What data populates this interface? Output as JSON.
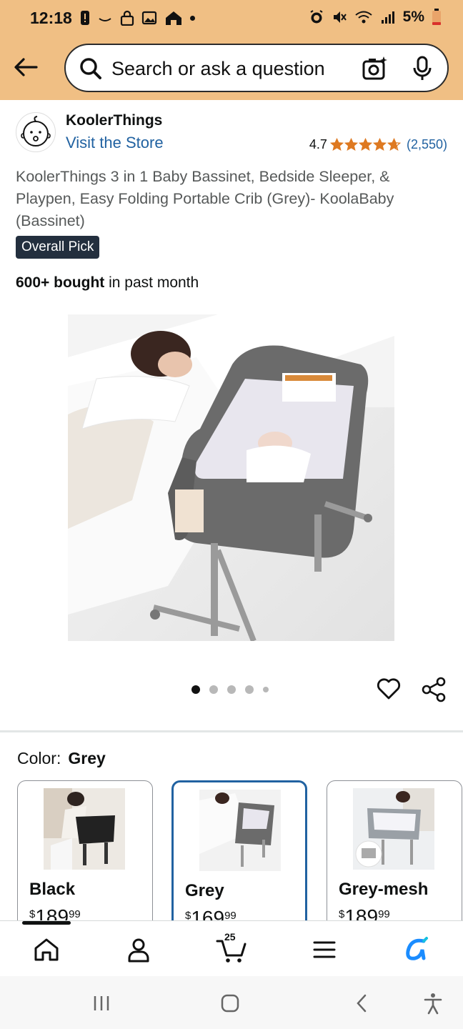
{
  "status_bar": {
    "time": "12:18",
    "battery": "5%"
  },
  "header": {
    "search_placeholder": "Search or ask a question",
    "bg_color": "#f0bf84"
  },
  "store": {
    "name": "KoolerThings",
    "visit_link": "Visit the Store",
    "rating_value": "4.7",
    "rating_count": "(2,550)",
    "stars": 4.7
  },
  "product": {
    "title": "KoolerThings 3 in 1 Baby Bassinet, Bedside Sleeper, & Playpen, Easy Folding Portable Crib (Grey)- KoolaBaby (Bassinet)",
    "badge": "Overall Pick",
    "bought_bold": "600+ bought",
    "bought_rest": " in past month",
    "image_count": 5,
    "active_image": 1
  },
  "color_selector": {
    "label": "Color:",
    "selected": "Grey",
    "options": [
      {
        "name": "Black",
        "currency": "$",
        "price_whole": "189",
        "price_frac": "99"
      },
      {
        "name": "Grey",
        "currency": "$",
        "price_whole": "169",
        "price_frac": "99"
      },
      {
        "name": "Grey-mesh",
        "currency": "$",
        "price_whole": "189",
        "price_frac": "99"
      }
    ]
  },
  "bottom_nav": {
    "cart_count": "25",
    "items": [
      "home-icon",
      "account-icon",
      "cart-icon",
      "menu-icon",
      "rufus-icon"
    ]
  },
  "colors": {
    "link": "#2162a1",
    "star": "#de7921",
    "badge_bg": "#232f3e",
    "selected_border": "#2162a1"
  }
}
